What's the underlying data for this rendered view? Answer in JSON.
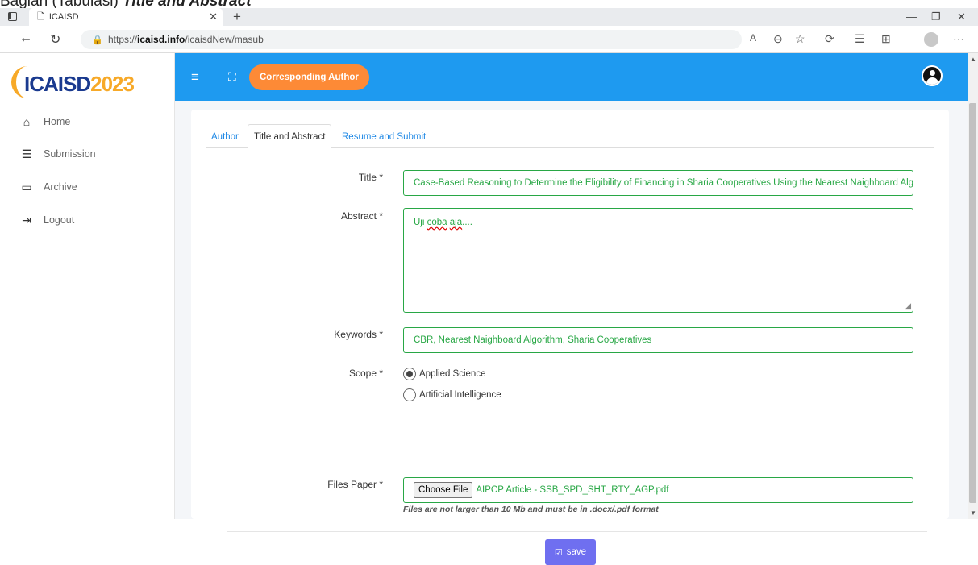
{
  "caption": {
    "prefix": "Bagian (Tabulasi) ",
    "emphasis": "Title and Abstract"
  },
  "browser": {
    "tab_title": "ICAISD",
    "url_scheme": "https://",
    "url_host": "icaisd.info",
    "url_path": "/icaisdNew/masub"
  },
  "logo": {
    "text": "ICAISD",
    "year": "2023"
  },
  "sidebar": {
    "items": [
      {
        "label": "Home",
        "icon": "home-icon"
      },
      {
        "label": "Submission",
        "icon": "list-icon"
      },
      {
        "label": "Archive",
        "icon": "inbox-icon"
      },
      {
        "label": "Logout",
        "icon": "logout-icon"
      }
    ]
  },
  "topbar": {
    "role_button": "Corresponding Author"
  },
  "tabs": [
    "Author",
    "Title and Abstract",
    "Resume and Submit"
  ],
  "form": {
    "title_label": "Title *",
    "title_value": "Case-Based Reasoning to Determine the Eligibility of Financing in Sharia Cooperatives Using the Nearest Naighboard Algorithm",
    "abstract_label": "Abstract *",
    "abstract_parts": {
      "a": "Uji ",
      "b": "coba",
      "c": " ",
      "d": "aja",
      "e": "...."
    },
    "keywords_label": "Keywords *",
    "keywords_value": "CBR, Nearest Naighboard Algorithm, Sharia Cooperatives",
    "scope_label": "Scope *",
    "scope_options": [
      "Applied Science",
      "Artificial Intelligence"
    ],
    "scope_selected": "Applied Science",
    "files_label": "Files Paper *",
    "choose_file": "Choose File",
    "file_name": "AIPCP Article - SSB_SPD_SHT_RTY_AGP.pdf",
    "file_hint": "Files are not larger than 10 Mb and must be in .docx/.pdf format",
    "save_label": "save"
  },
  "colors": {
    "topbar": "#1e9af0",
    "accent_orange": "#fd8a36",
    "valid_green": "#28a745",
    "save_button": "#6f6ff0"
  }
}
